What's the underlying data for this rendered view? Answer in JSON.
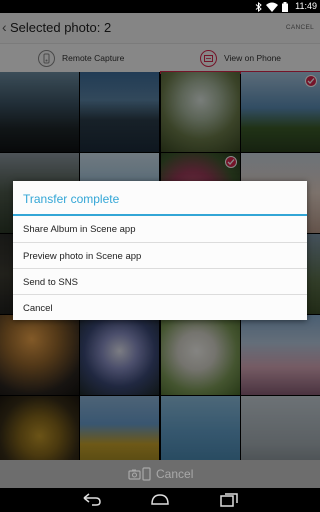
{
  "status_bar": {
    "time": "11:49",
    "icons": [
      "bluetooth-icon",
      "wifi-icon",
      "battery-icon"
    ]
  },
  "action_bar": {
    "back_glyph": "‹",
    "title": "Selected photo: 2",
    "cancel_label": "CANCEL"
  },
  "tabs": [
    {
      "label": "Remote Capture",
      "icon": "camera-remote-icon",
      "active": false
    },
    {
      "label": "View on Phone",
      "icon": "phone-view-icon",
      "active": true
    }
  ],
  "colors": {
    "accent": "#d6264d",
    "dialog_accent": "#33a6d6"
  },
  "dialog": {
    "title": "Transfer complete",
    "options": [
      "Share Album in Scene app",
      "Preview photo in Scene app",
      "Send to SNS",
      "Cancel"
    ]
  },
  "bottom_bar": {
    "label": "Cancel",
    "icon": "camera-phone-icon"
  },
  "navigation_bar": {
    "buttons": [
      "back-icon",
      "home-icon",
      "recent-apps-icon"
    ]
  }
}
